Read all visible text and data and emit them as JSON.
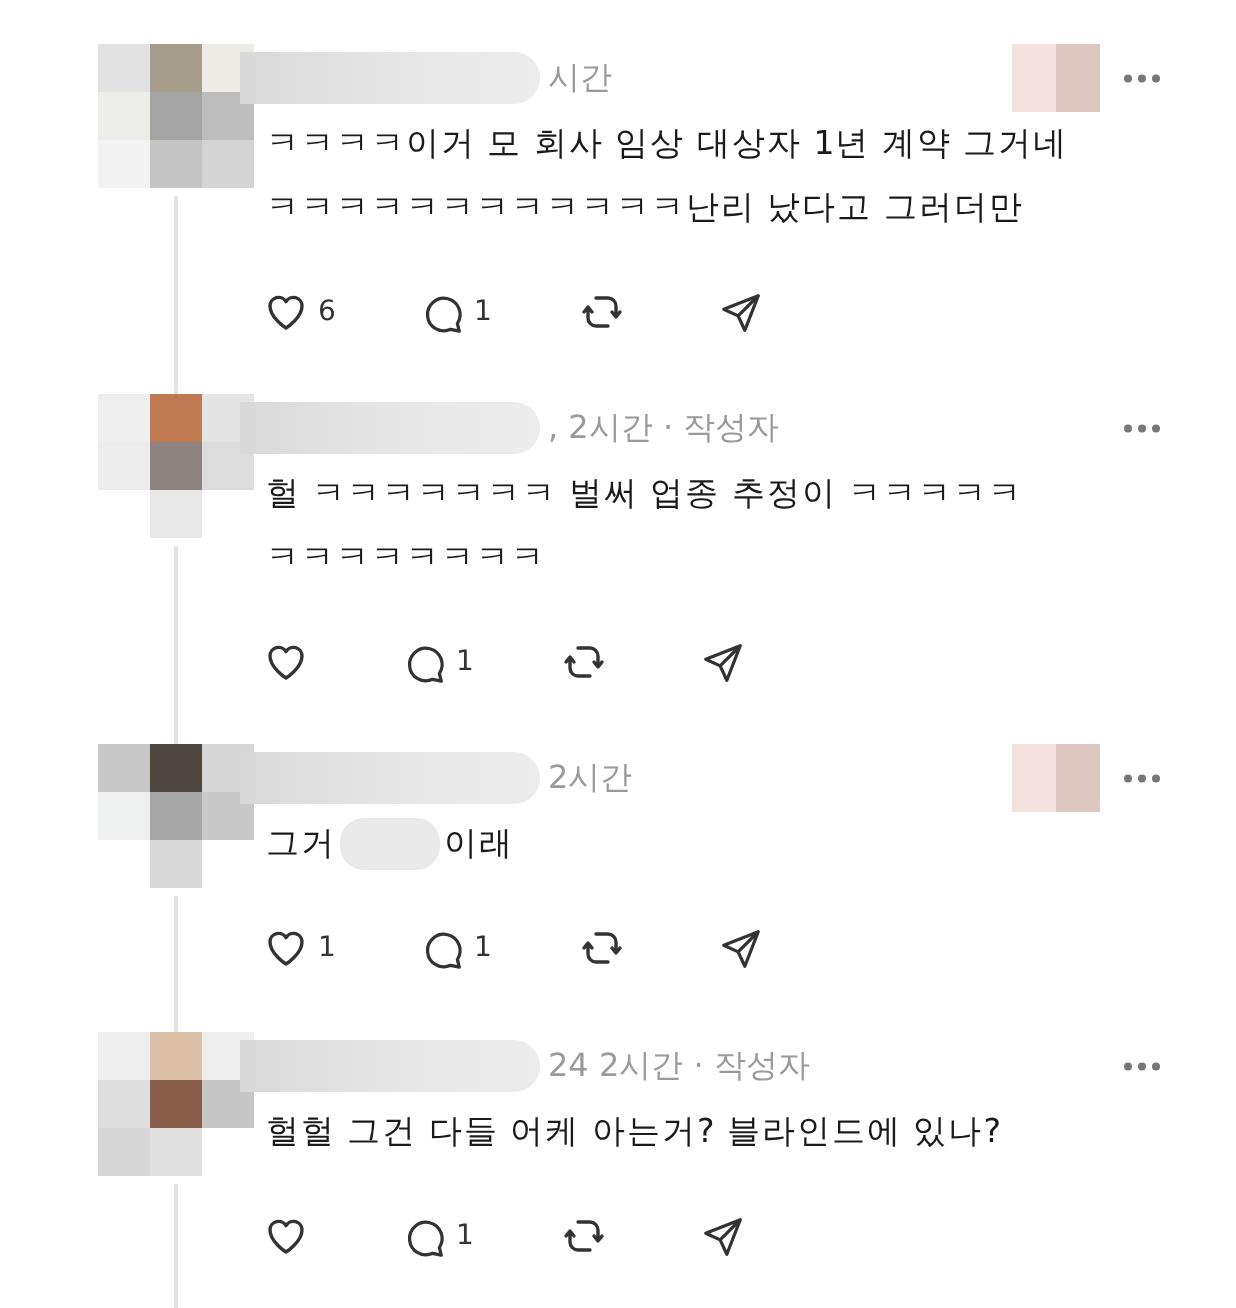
{
  "comments": [
    {
      "time": "시간",
      "lines": [
        [
          "ㅋㅋㅋㅋ이거 모 회사 임상 대상자 1년 계약 그거네"
        ],
        [
          "ㅋㅋㅋㅋㅋㅋㅋㅋㅋㅋㅋㅋ난리 났다고 그러더만"
        ]
      ],
      "likes": "6",
      "replies": "1",
      "side_blur": true
    },
    {
      "time": ", 2시간 · 작성자",
      "lines": [
        [
          "헐 ㅋㅋㅋㅋㅋㅋㅋ 벌써 업종 추정이 ㅋㅋㅋㅋㅋ"
        ],
        [
          "ㅋㅋㅋㅋㅋㅋㅋㅋ"
        ]
      ],
      "replies": "1",
      "side_blur": false
    },
    {
      "time": "2시간",
      "lines": [
        [
          "그거",
          "이래"
        ]
      ],
      "likes": "1",
      "replies": "1",
      "side_blur": true
    },
    {
      "time": "24 2시간 · 작성자",
      "lines": [
        [
          "헐헐 그건 다들 어케 아는거? 블라인드에 있나?"
        ]
      ],
      "replies": "1",
      "side_blur": false
    }
  ]
}
